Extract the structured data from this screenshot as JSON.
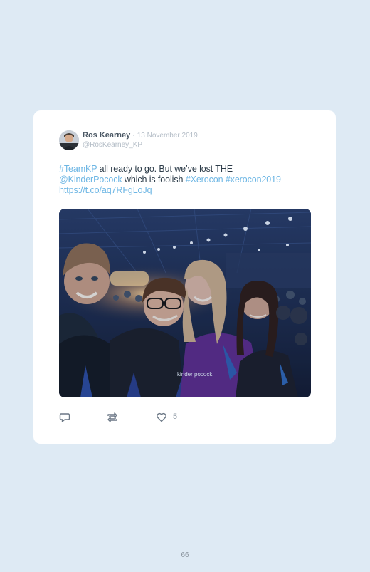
{
  "tweet": {
    "author_name": "Ros Kearney",
    "separator": "·",
    "date": "13 November 2019",
    "handle": "@RosKearney_KP",
    "text_parts": {
      "hashtag_teamkp": "#TeamKP",
      "text_1": " all ready to go. But we’ve lost THE",
      "mention_kinderpocock": "@KinderPocock",
      "text_2": " which is foolish ",
      "hashtag_xerocon": "#Xerocon",
      "text_3": " ",
      "hashtag_xerocon2019": "#xerocon2019",
      "link": "https://t.co/aq7RFgLoJq"
    },
    "photo_shirt_text": "kinder pocock",
    "likes": "5"
  },
  "icons": {
    "reply": "reply-icon",
    "retweet": "retweet-icon",
    "like": "heart-icon"
  },
  "colors": {
    "page_background": "#deeaf4",
    "card_background": "#ffffff",
    "link": "#6db6e4",
    "text": "#2e3d4a",
    "muted": "#b3bcc6"
  },
  "page": {
    "number": "66"
  }
}
